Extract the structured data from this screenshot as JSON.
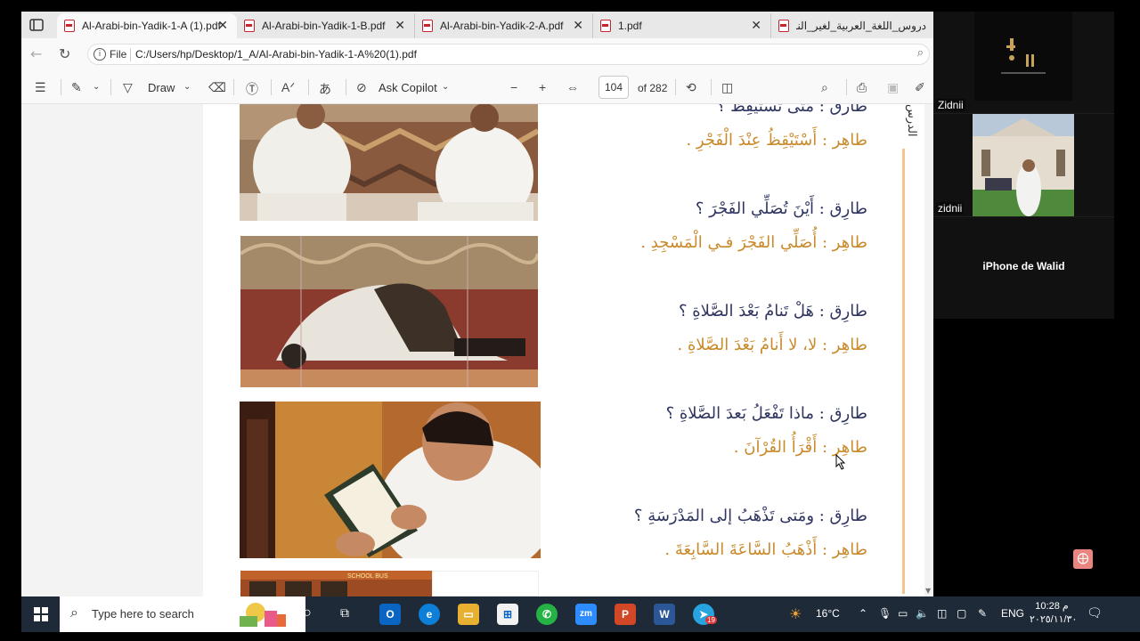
{
  "browser": {
    "tabs": [
      {
        "label": "Al-Arabi-bin-Yadik-1-A (1).pdf",
        "active": true
      },
      {
        "label": "Al-Arabi-bin-Yadik-1-B.pdf",
        "active": false
      },
      {
        "label": "Al-Arabi-bin-Yadik-2-A.pdf",
        "active": false
      },
      {
        "label": "1.pdf",
        "active": false
      },
      {
        "label": "دروس_اللغة_العربية_لغير_الناطقين",
        "active": false
      }
    ],
    "address": {
      "scheme": "File",
      "url": "C:/Users/hp/Desktop/1_A/Al-Arabi-bin-Yadik-1-A%20(1).pdf"
    }
  },
  "pdf_toolbar": {
    "draw_label": "Draw",
    "copilot_label": "Ask Copilot",
    "page_current": "104",
    "page_total": "of 282"
  },
  "pdf_page": {
    "side_text": "الدرس",
    "dialogue": [
      {
        "speaker": "طارق",
        "text": "مَتَى تَسْتَيْقِظُ ؟",
        "role": "q"
      },
      {
        "speaker": "طاهِر",
        "text": "أَسْتَيْقِظُ عِنْدَ الْفَجْرِ .",
        "role": "a"
      },
      {
        "speaker": "طارِق",
        "text": "أَيْنَ تُصَلِّي الفَجْرَ ؟",
        "role": "q"
      },
      {
        "speaker": "طاهِر",
        "text": "أُصَلِّي الفَجْرَ فـي الْمَسْجِدِ .",
        "role": "a"
      },
      {
        "speaker": "طارِق",
        "text": "هَلْ تَنامُ بَعْدَ الصَّلاةِ ؟",
        "role": "q"
      },
      {
        "speaker": "طاهِر",
        "text": "لا، لا أَنامُ بَعْدَ الصَّلاةِ .",
        "role": "a"
      },
      {
        "speaker": "طارِق",
        "text": "ماذا تَفْعَلُ بَعدَ الصَّلاةِ ؟",
        "role": "q"
      },
      {
        "speaker": "طاهِر",
        "text": "أَقْرَأُ القُرْآنَ .",
        "role": "a"
      },
      {
        "speaker": "طارِق",
        "text": "ومَتى تَذْهَبُ إلى المَدْرَسَةِ ؟",
        "role": "q"
      },
      {
        "speaker": "طاهِر",
        "text": "أَذْهَبُ السَّاعَةَ السَّابِعَةَ .",
        "role": "a"
      }
    ],
    "photo_sign_text": "SCHOOL BUS"
  },
  "zoom": {
    "tiles": [
      {
        "name": "Zidnii"
      },
      {
        "name": "zidnii"
      },
      {
        "name": "iPhone de Walid"
      }
    ]
  },
  "taskbar": {
    "search_placeholder": "Type here to search",
    "weather": "16°C",
    "language": "ENG",
    "time": "10:28 م",
    "date": "٢٠٢٥/١١/٣٠",
    "telegram_badge": "19",
    "apps": [
      "task-view",
      "explorer",
      "outlook",
      "edge",
      "file-explorer",
      "store",
      "whatsapp",
      "zoom",
      "powerpoint",
      "word",
      "telegram"
    ]
  },
  "colors": {
    "question_text": "#2f3560",
    "answer_text": "#c98a2b",
    "taskbar": "#1f2a38",
    "pdf_icon": "#c4262e"
  }
}
